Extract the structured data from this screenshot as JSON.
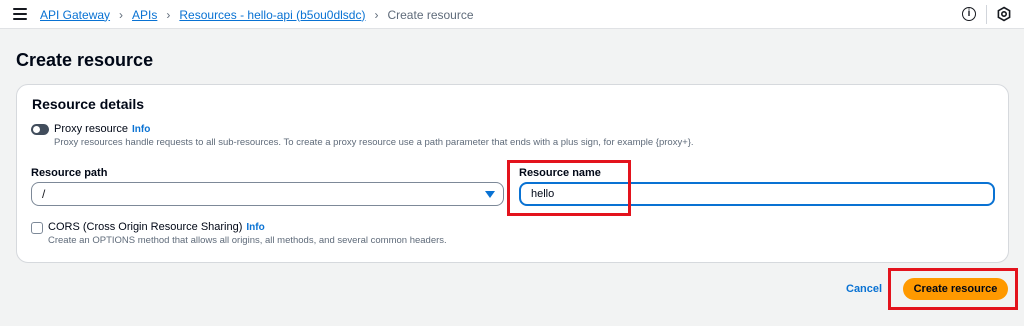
{
  "breadcrumb": {
    "items": [
      "API Gateway",
      "APIs",
      "Resources - hello-api (b5ou0dlsdc)"
    ],
    "current": "Create resource",
    "separator": "›"
  },
  "header_icons": [
    "menu-icon",
    "info-icon",
    "settings-icon"
  ],
  "page": {
    "title": "Create resource"
  },
  "details": {
    "title": "Resource details",
    "proxy": {
      "label": "Proxy resource",
      "info": "Info",
      "enabled": false,
      "description": "Proxy resources handle requests to all sub-resources. To create a proxy resource use a path parameter that ends with a plus sign, for example {proxy+}."
    },
    "path": {
      "label": "Resource path",
      "value": "/"
    },
    "name": {
      "label": "Resource name",
      "value": "hello"
    },
    "cors": {
      "label": "CORS (Cross Origin Resource Sharing)",
      "info": "Info",
      "checked": false,
      "description": "Create an OPTIONS method that allows all origins, all methods, and several common headers."
    }
  },
  "actions": {
    "cancel": "Cancel",
    "create": "Create resource"
  },
  "colors": {
    "link": "#0972d3",
    "primary": "#ff9900",
    "highlight": "#e3131d",
    "background": "#f2f3f3"
  }
}
